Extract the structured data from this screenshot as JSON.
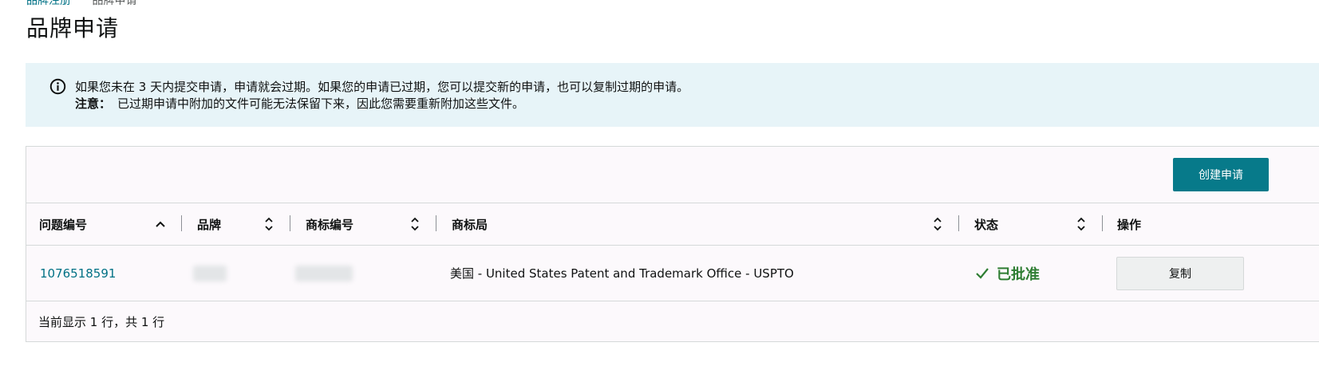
{
  "breadcrumb": {
    "parent": "品牌注册",
    "current": "品牌申请"
  },
  "page_title": "品牌申请",
  "alert": {
    "icon": "info-icon",
    "line1": "如果您未在 3 天内提交申请，申请就会过期。如果您的申请已过期，您可以提交新的申请，也可以复制过期的申请。",
    "note_label": "注意：",
    "note_text": "已过期申请中附加的文件可能无法保留下来，因此您需要重新附加这些文件。"
  },
  "toolbar": {
    "create_label": "创建申请"
  },
  "table": {
    "columns": {
      "issue_no": "问题编号",
      "brand": "品牌",
      "trademark_no": "商标编号",
      "office": "商标局",
      "status": "状态",
      "action": "操作"
    },
    "rows": [
      {
        "issue_no": "1076518591",
        "brand": "",
        "trademark_no": "",
        "office": "美国 - United States Patent and Trademark Office - USPTO",
        "status": "已批准",
        "action_label": "复制"
      }
    ],
    "footer": "当前显示 1 行，共 1 行"
  },
  "colors": {
    "accent": "#077a8a",
    "link": "#007185",
    "approved": "#2e7d32",
    "alert_bg": "#e7f4f8"
  }
}
